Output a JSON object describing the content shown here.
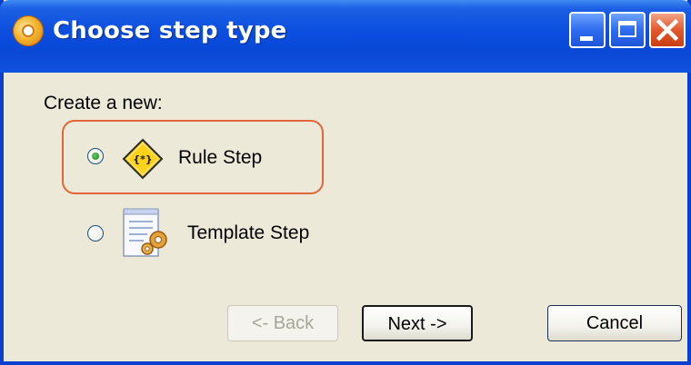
{
  "window": {
    "title": "Choose step type"
  },
  "form": {
    "prompt": "Create a new:",
    "options": [
      {
        "label": "Rule Step",
        "selected": true,
        "icon": "rule-step-icon"
      },
      {
        "label": "Template Step",
        "selected": false,
        "icon": "template-step-icon"
      }
    ],
    "rule_icon_text": "{*}"
  },
  "buttons": {
    "back": "<- Back",
    "next": "Next ->",
    "cancel": "Cancel"
  },
  "colors": {
    "titlebar": "#0a48d6",
    "highlight_border": "#e2663a",
    "close_button": "#e2582c",
    "background": "#ece9d8"
  }
}
